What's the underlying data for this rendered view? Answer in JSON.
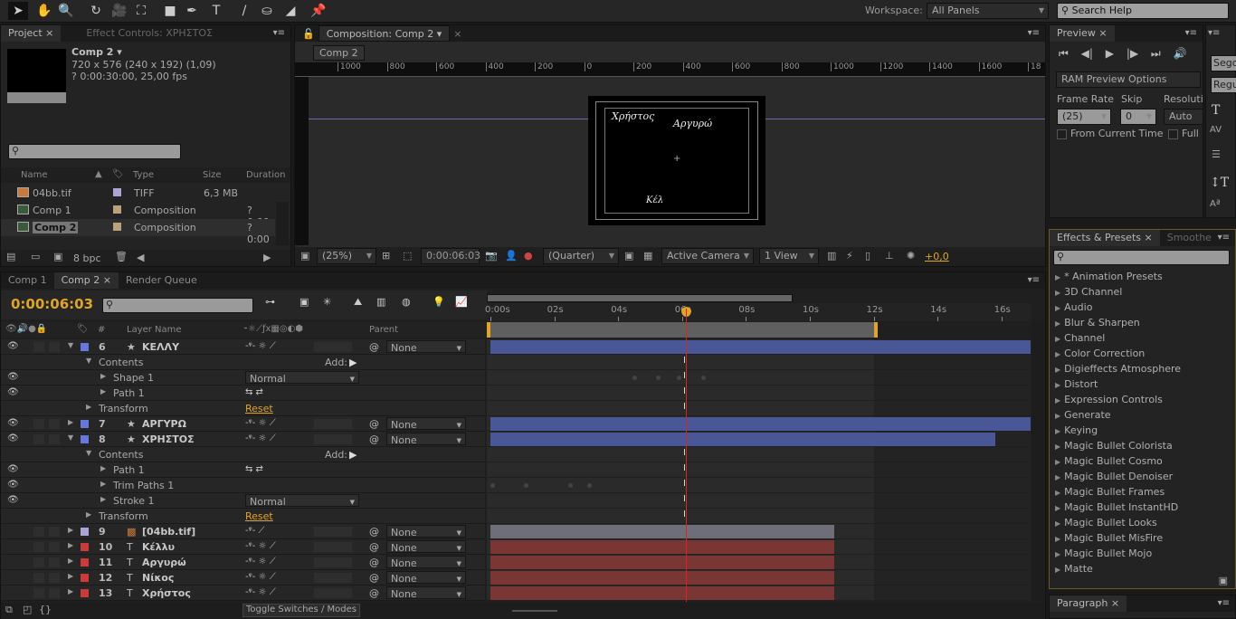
{
  "toolbar": {
    "tools": [
      "selection-tool",
      "hand-tool",
      "zoom-tool",
      "rotation-tool",
      "camera-tool",
      "pan-behind-tool",
      "rectangle-tool",
      "pen-tool",
      "type-tool",
      "brush-tool",
      "clone-stamp-tool",
      "eraser-tool",
      "puppet-tool"
    ],
    "workspace_label": "Workspace:",
    "workspace_value": "All Panels",
    "search_placeholder": "Search Help"
  },
  "project": {
    "tabs": [
      "Project",
      "Effect Controls: ΧΡΗΣΤΟΣ"
    ],
    "comp_name": "Comp 2 ▾",
    "comp_size": "720 x 576  (240 x 192) (1,09)",
    "comp_duration": "? 0:00:30:00, 25,00 fps",
    "columns": [
      "Name",
      "Type",
      "Size",
      "Duration"
    ],
    "items": [
      {
        "name": "04bb.tif",
        "type": "TIFF",
        "size": "6,3 MB",
        "duration": "",
        "label": "#a9a6d6"
      },
      {
        "name": "Comp 1",
        "type": "Composition",
        "size": "",
        "duration": "? 0:00",
        "label": "#b9a27c"
      },
      {
        "name": "Comp 2",
        "type": "Composition",
        "size": "",
        "duration": "? 0:00",
        "label": "#b9a27c",
        "selected": true
      }
    ],
    "bpc": "8 bpc"
  },
  "composition": {
    "tab": "Composition: Comp 2",
    "crumb": "Comp 2",
    "ruler": [
      "1000",
      "800",
      "600",
      "400",
      "200",
      "0",
      "200",
      "400",
      "600",
      "800",
      "1000",
      "1200",
      "1400",
      "1600",
      "18"
    ],
    "canvas_text": [
      "Χρήστος",
      "Αργυρώ",
      "Κέλ"
    ],
    "zoom": "(25%)",
    "timecode": "0:00:06:03",
    "resolution": "(Quarter)",
    "camera": "Active Camera",
    "views": "1 View",
    "exposure": "+0,0"
  },
  "preview": {
    "tab": "Preview",
    "ram_options": "RAM Preview Options",
    "frame_rate_label": "Frame Rate",
    "skip_label": "Skip",
    "resolution_label": "Resoluti",
    "frame_rate": "(25)",
    "skip": "0",
    "resolution": "Auto",
    "from_current": "From Current Time",
    "full": "Full"
  },
  "character": {
    "font": "Sego",
    "style": "Regu"
  },
  "effects": {
    "tabs": [
      "Effects & Presets",
      "Smoothe"
    ],
    "items": [
      "* Animation Presets",
      "3D Channel",
      "Audio",
      "Blur & Sharpen",
      "Channel",
      "Color Correction",
      "Digieffects Atmosphere",
      "Distort",
      "Expression Controls",
      "Generate",
      "Keying",
      "Magic Bullet Colorista",
      "Magic Bullet Cosmo",
      "Magic Bullet Denoiser",
      "Magic Bullet Frames",
      "Magic Bullet InstantHD",
      "Magic Bullet Looks",
      "Magic Bullet MisFire",
      "Magic Bullet Mojo",
      "Matte"
    ]
  },
  "paragraph": {
    "tab": "Paragraph"
  },
  "timeline": {
    "tabs": [
      "Comp 1",
      "Comp 2",
      "Render Queue"
    ],
    "current_time": "0:00:06:03",
    "current_seconds": 6.12,
    "header": {
      "hash": "#",
      "layer_name": "Layer Name",
      "parent": "Parent"
    },
    "ticks": [
      "0:00s",
      "02s",
      "04s",
      "06s",
      "08s",
      "10s",
      "12s",
      "14s",
      "16s"
    ],
    "work_area_end": 12,
    "toggle_label": "Toggle Switches / Modes",
    "rows": [
      {
        "kind": "layer",
        "num": "6",
        "name": "ΚΕΛΛΥ",
        "icon": "star",
        "color": "#6677dd",
        "expanded": true,
        "parent": "None",
        "bar": "#4a5796",
        "in": 0,
        "out": 18
      },
      {
        "kind": "group",
        "name": "Contents",
        "add": "Add:"
      },
      {
        "kind": "prop",
        "name": "Shape 1",
        "mode": "Normal",
        "keys": [
          4.5,
          5.25,
          5.9,
          6.65
        ]
      },
      {
        "kind": "prop",
        "name": "Path 1",
        "pathicons": true
      },
      {
        "kind": "group",
        "name": "Transform",
        "reset": "Reset"
      },
      {
        "kind": "layer",
        "num": "7",
        "name": "ΑΡΓΥΡΩ",
        "icon": "star",
        "color": "#6677dd",
        "parent": "None",
        "bar": "#4a5796",
        "in": 0,
        "out": 18
      },
      {
        "kind": "layer",
        "num": "8",
        "name": "ΧΡΗΣΤΟΣ",
        "icon": "star",
        "color": "#6677dd",
        "expanded": true,
        "parent": "None",
        "bar": "#4a5796",
        "in": 0,
        "out": 15.8
      },
      {
        "kind": "group",
        "name": "Contents",
        "add": "Add:"
      },
      {
        "kind": "prop",
        "name": "Path 1",
        "pathicons": true
      },
      {
        "kind": "prop",
        "name": "Trim Paths 1",
        "keys": [
          0.05,
          1.1,
          2.5,
          3.1
        ]
      },
      {
        "kind": "prop",
        "name": "Stroke 1",
        "mode": "Normal"
      },
      {
        "kind": "group",
        "name": "Transform",
        "reset": "Reset"
      },
      {
        "kind": "layer",
        "num": "9",
        "name": "[04bb.tif]",
        "icon": "image",
        "color": "#a9a6d6",
        "parent": "None",
        "bar": "#6e6e78",
        "in": 0,
        "out": 10.76
      },
      {
        "kind": "layer",
        "num": "10",
        "name": "Κέλλυ",
        "icon": "text",
        "color": "#cc3a3a",
        "parent": "None",
        "bar": "#7a3535",
        "in": 0,
        "out": 10.76
      },
      {
        "kind": "layer",
        "num": "11",
        "name": "Αργυρώ",
        "icon": "text",
        "color": "#cc3a3a",
        "parent": "None",
        "bar": "#7a3535",
        "in": 0,
        "out": 10.76
      },
      {
        "kind": "layer",
        "num": "12",
        "name": "Νίκος",
        "icon": "text",
        "color": "#cc3a3a",
        "parent": "None",
        "bar": "#7a3535",
        "in": 0,
        "out": 10.76
      },
      {
        "kind": "layer",
        "num": "13",
        "name": "Χρήστος",
        "icon": "text",
        "color": "#cc3a3a",
        "parent": "None",
        "bar": "#7a3535",
        "in": 0,
        "out": 10.76
      }
    ]
  },
  "colors": {
    "accent": "#e0a526",
    "playhead": "#d22",
    "shape_layer": "#4a5796",
    "text_layer": "#7a3535"
  }
}
